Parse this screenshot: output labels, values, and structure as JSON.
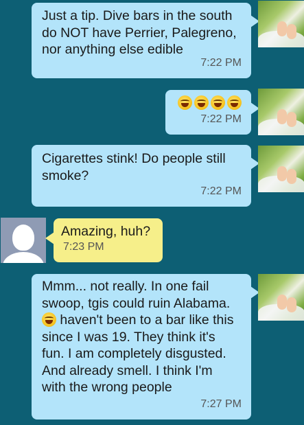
{
  "messages": [
    {
      "text": "Just a tip. Dive bars in the south\ndo NOT have Perrier, Palegreno,\nnor anything else edible",
      "time": "7:22 PM"
    },
    {
      "emoji_count": 4,
      "emoji": "laughing-face",
      "time": "7:22 PM"
    },
    {
      "text": "Cigarettes stink! Do people still\nsmoke?",
      "time": "7:22 PM"
    },
    {
      "text": "Amazing, huh?",
      "time": "7:23 PM"
    },
    {
      "line1": "Mmm... not really.  In one fail",
      "line2": "swoop, tgis could ruin Alabama.",
      "line3": " haven't been to a bar like this",
      "rest": "since I was 19. They think it's\nfun. I am completely disgusted.\nAnd already smell. I think I'm\nwith the wrong people",
      "time": "7:27 PM"
    }
  ],
  "colors": {
    "background": "#0d5f74",
    "outgoing_bubble": "#b3e4fa",
    "incoming_bubble": "#f6ef8a",
    "timestamp": "#555555"
  }
}
